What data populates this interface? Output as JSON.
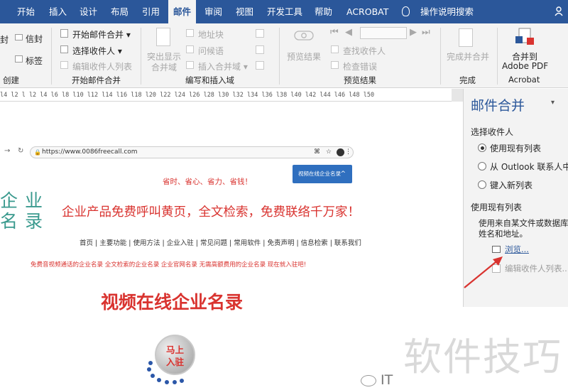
{
  "tabs": [
    "开始",
    "插入",
    "设计",
    "布局",
    "引用",
    "邮件",
    "审阅",
    "视图",
    "开发工具",
    "帮助",
    "ACROBAT"
  ],
  "active_tab": "邮件",
  "tell_me": "操作说明搜索",
  "ribbon": {
    "create_group": {
      "label": "创建",
      "envelopes": "信封",
      "labels": "标签",
      "envelopes_cut": "封"
    },
    "start_group": {
      "label": "开始邮件合并",
      "start_merge": "开始邮件合并",
      "select_recipients": "选择收件人",
      "edit_list": "编辑收件人列表"
    },
    "write_group": {
      "label": "编写和插入域",
      "highlight_l1": "突出显示",
      "highlight_l2": "合并域",
      "address_block": "地址块",
      "greeting": "问候语",
      "insert_field": "插入合并域"
    },
    "preview_group": {
      "label": "预览结果",
      "preview": "预览结果",
      "find": "查找收件人",
      "check": "检查错误"
    },
    "finish_group": {
      "label": "完成",
      "finish": "完成并合并"
    },
    "acrobat_group": {
      "label": "Acrobat",
      "merge_l1": "合并到",
      "merge_l2": "Adobe PDF"
    }
  },
  "ruler": "l4  l2  l  l2  l4  l6  l8  l10  l12  l14  l16  l18  l20  l22  l24  l26  l28  l30  l32  l34  l36  l38  l40  l42  l44  l46  l48  l50",
  "document": {
    "url": "https://www.0086freecall.com",
    "dir_button": "视频在线企业名录",
    "slogan_small": "省时、省心、省力、省钱！",
    "slogan_big": "企业产品免费呼叫黄页，全文检索，免费联络千万家！",
    "logo_l1": "企 业",
    "logo_l2": "名 录",
    "nav": "首页 | 主要功能 | 使用方法 | 企业入驻 | 常见问题 | 常用软件 | 免责声明 | 信息检索 | 联系我们",
    "links": "免费音视频通话的企业名录  全文检索的企业名录  企业官网名录  无需高额费用的企业名录  现在就入驻吧!",
    "title": "视频在线企业名录",
    "join_l1": "马上",
    "join_l2": "入驻"
  },
  "pane": {
    "title": "邮件合并",
    "section1": "选择收件人",
    "opt1": "使用现有列表",
    "opt2": "从 Outlook 联系人中选",
    "opt3": "键入新列表",
    "section2": "使用现有列表",
    "desc_l1": "使用来自某文件或数据库",
    "desc_l2": "姓名和地址。",
    "browse": "浏览...",
    "edit_list": "编辑收件人列表..."
  },
  "watermark": "软件技巧",
  "wechat_label": "IT",
  "colors": {
    "ribbon_blue": "#2b579a",
    "accent_red": "#d9332f",
    "logo_teal": "#3a9a8e"
  }
}
